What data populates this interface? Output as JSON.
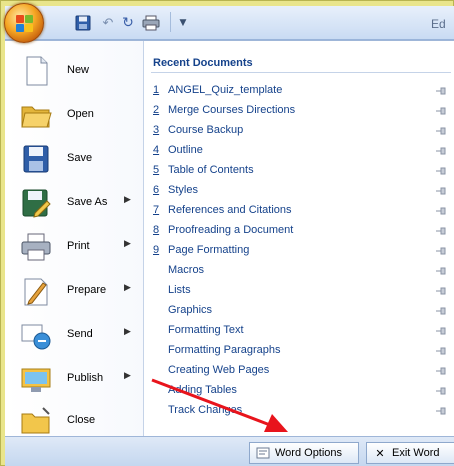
{
  "title_bar": {
    "app_title": "Ed"
  },
  "quick_access": {
    "undo_glyph": "↶",
    "redo_glyph": "↻",
    "more_glyph": "▼"
  },
  "commands": [
    {
      "label": "New",
      "icon": "new-document-icon",
      "submenu": false
    },
    {
      "label": "Open",
      "icon": "open-folder-icon",
      "submenu": false
    },
    {
      "label": "Save",
      "icon": "save-disk-icon",
      "submenu": false
    },
    {
      "label": "Save As",
      "icon": "save-as-icon",
      "submenu": true
    },
    {
      "label": "Print",
      "icon": "printer-icon",
      "submenu": true
    },
    {
      "label": "Prepare",
      "icon": "prepare-icon",
      "submenu": true
    },
    {
      "label": "Send",
      "icon": "send-icon",
      "submenu": true
    },
    {
      "label": "Publish",
      "icon": "publish-icon",
      "submenu": true
    },
    {
      "label": "Close",
      "icon": "close-folder-icon",
      "submenu": false
    }
  ],
  "submenu_arrow": "▶",
  "recent": {
    "title": "Recent Documents",
    "items": [
      {
        "num": "1",
        "name": "ANGEL_Quiz_template"
      },
      {
        "num": "2",
        "name": "Merge Courses Directions"
      },
      {
        "num": "3",
        "name": "Course Backup"
      },
      {
        "num": "4",
        "name": "Outline"
      },
      {
        "num": "5",
        "name": "Table of Contents"
      },
      {
        "num": "6",
        "name": "Styles"
      },
      {
        "num": "7",
        "name": "References and Citations"
      },
      {
        "num": "8",
        "name": "Proofreading a Document"
      },
      {
        "num": "9",
        "name": "Page Formatting"
      },
      {
        "num": "",
        "name": "Macros"
      },
      {
        "num": "",
        "name": "Lists"
      },
      {
        "num": "",
        "name": "Graphics"
      },
      {
        "num": "",
        "name": "Formatting Text"
      },
      {
        "num": "",
        "name": "Formatting Paragraphs"
      },
      {
        "num": "",
        "name": "Creating Web Pages"
      },
      {
        "num": "",
        "name": "Adding Tables"
      },
      {
        "num": "",
        "name": "Track Changes"
      }
    ]
  },
  "bottom": {
    "word_options_label": "Word Options",
    "exit_word_label": "Exit Word",
    "exit_glyph": "✕"
  },
  "colors": {
    "accent": "#15428b",
    "frame": "#e9e58b",
    "annotation_arrow": "#e8141c"
  }
}
